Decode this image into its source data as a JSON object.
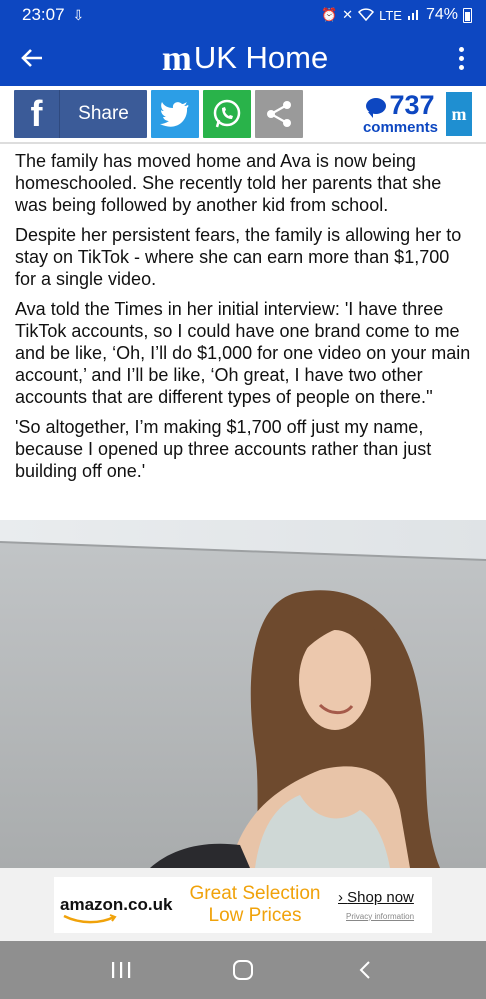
{
  "status_bar": {
    "time": "23:07",
    "battery": "74%",
    "network": "LTE"
  },
  "app_bar": {
    "logo": "m",
    "title": "UK Home"
  },
  "share_bar": {
    "share_label": "Share",
    "comment_count": "737",
    "comments_label": "comments",
    "dm_badge": "m"
  },
  "article": {
    "paragraphs": [
      "The family has moved home and Ava is now being homeschooled. She recently told her parents that she was being followed by another kid from school.",
      "Despite her persistent fears, the family is allowing her to stay on TikTok - where she can earn more than $1,700 for a single video.",
      "Ava told the Times in her initial interview: 'I have three TikTok accounts, so I could have one brand come to me and be like, ‘Oh, I’ll do $1,000 for one video on your main account,’ and I’ll be like, ‘Oh great, I have two other accounts that are different types of people on there.''",
      "'So altogether, I’m making $1,700 off just my name, because I opened up three accounts rather than just building off one.'"
    ]
  },
  "ad": {
    "brand": "amazon.co.uk",
    "line1": "Great Selection",
    "line2": "Low Prices",
    "cta": "Shop now",
    "privacy": "Privacy information"
  },
  "colors": {
    "brand_blue": "#0d47c1",
    "facebook": "#3b5b98",
    "twitter": "#2c9ee6",
    "whatsapp": "#29b34a",
    "share_gray": "#9a9a9a",
    "amazon_orange": "#f0a20a"
  },
  "icons": {
    "back": "arrow-left-icon",
    "menu": "more-vertical-icon",
    "facebook": "facebook-icon",
    "twitter": "twitter-icon",
    "whatsapp": "whatsapp-icon",
    "share": "share-icon",
    "nav_recent": "recent-apps-icon",
    "nav_home": "home-icon",
    "nav_back": "chevron-left-icon"
  }
}
